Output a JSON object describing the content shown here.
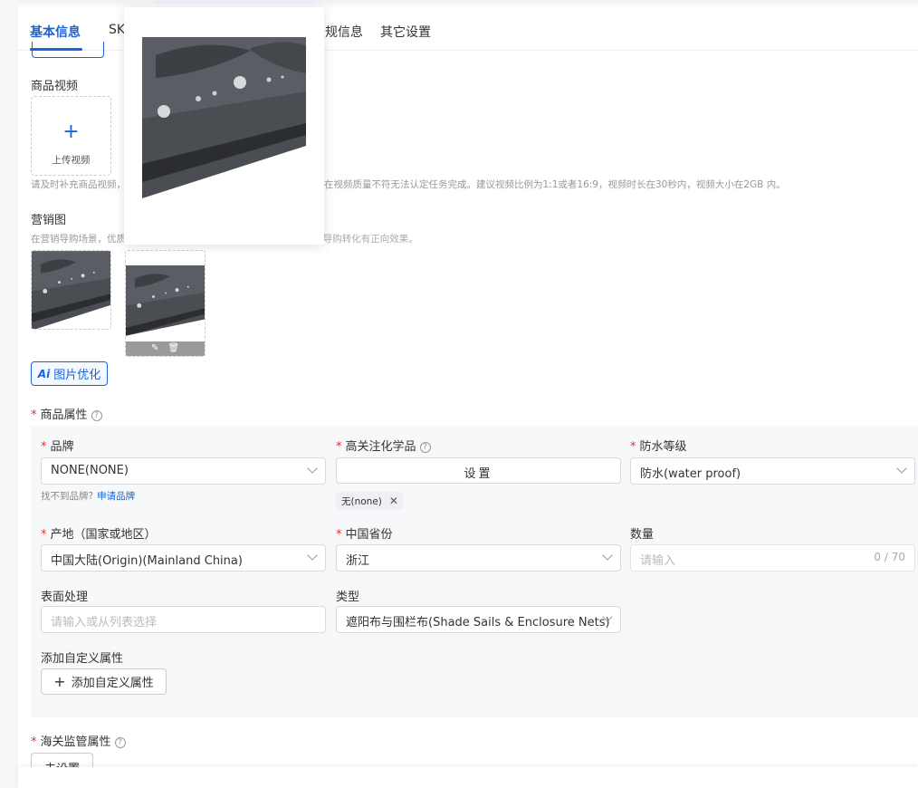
{
  "tabs": [
    {
      "label": "基本信息",
      "active": true
    },
    {
      "label": "SK"
    },
    {
      "label": "规信息"
    },
    {
      "label": "其它设置"
    }
  ],
  "video": {
    "section_label": "商品视频",
    "upload_label": "上传视频",
    "upload_icon": "plus-icon",
    "hint_left": "请及时补充商品视频，",
    "hint_right": "在视频质量不符无法认定任务完成。建议视频比例为1:1或者16:9，视频时长在30秒内，视频大小在2GB 内。"
  },
  "marketing": {
    "section_label": "营销图",
    "hint_left": "在营销导购场景，优质的",
    "hint_right": "商品图片（1:1白底图、3:4场景图）对导购转化有正向效果。",
    "edit_icon": "edit-icon",
    "delete_icon": "trash-icon"
  },
  "ai_button": {
    "prefix": "Ai",
    "label": "图片优化"
  },
  "attributes": {
    "section_label": "商品属性",
    "brand": {
      "label": "品牌",
      "value": "NONE(NONE)",
      "helper": "找不到品牌?",
      "helper_link": "申请品牌"
    },
    "chemical": {
      "label": "高关注化学品",
      "button": "设置",
      "tag": "无(none)"
    },
    "waterproof": {
      "label": "防水等级",
      "value": "防水(water proof)"
    },
    "origin": {
      "label": "产地（国家或地区）",
      "value": "中国大陆(Origin)(Mainland China)"
    },
    "province": {
      "label": "中国省份",
      "value": "浙江"
    },
    "quantity": {
      "label": "数量",
      "placeholder": "请输入",
      "counter": "0 / 70"
    },
    "surface": {
      "label": "表面处理",
      "placeholder": "请输入或从列表选择"
    },
    "type": {
      "label": "类型",
      "value": "遮阳布与围栏布(Shade Sails & Enclosure Nets)"
    },
    "custom": {
      "label": "添加自定义属性",
      "button": "添加自定义属性"
    }
  },
  "customs": {
    "section_label": "海关监管属性",
    "button": "去设置"
  },
  "colors": {
    "accent": "#1a64d6",
    "required": "#e0312c",
    "panel_bg": "#f7f8fa"
  }
}
